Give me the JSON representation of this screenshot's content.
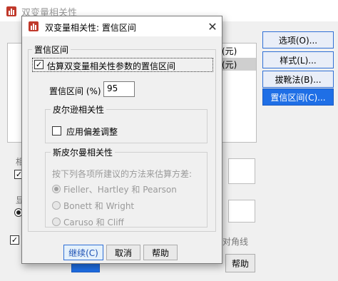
{
  "parent": {
    "title": "双变量相关性",
    "buttons": [
      "选项(O)...",
      "样式(L)...",
      "拔靴法(B)...",
      "置信区间(C)..."
    ],
    "list_items": [
      "(元)",
      "(元)"
    ],
    "bottom_help": "帮助",
    "partial_label": "对角线",
    "partial_letters": [
      "相",
      "显"
    ]
  },
  "dialog": {
    "title": "双变量相关性: 置信区间",
    "close": "✕",
    "group_ci": "置信区间",
    "estimate_checkbox": {
      "label": "估算双变量相关性参数的置信区间",
      "checked": true,
      "mark": "✓"
    },
    "ci_label": "置信区间 (%)",
    "ci_value": "95",
    "group_pearson": "皮尔逊相关性",
    "bias_checkbox": {
      "label": "应用偏差调整",
      "checked": false
    },
    "group_spearman": "斯皮尔曼相关性",
    "spearman_prompt": "按下列各项所建议的方法来估算方差:",
    "radios": [
      "Fieller、Hartley 和 Pearson",
      "Bonett 和 Wright",
      "Caruso 和 Cliff"
    ],
    "buttons": {
      "continue": "继续(C)",
      "cancel": "取消",
      "help": "帮助"
    }
  },
  "colors": {
    "accent": "#1f6fe6",
    "title_bg": "#ffffff",
    "dialog_bg": "#f0f0f0"
  }
}
